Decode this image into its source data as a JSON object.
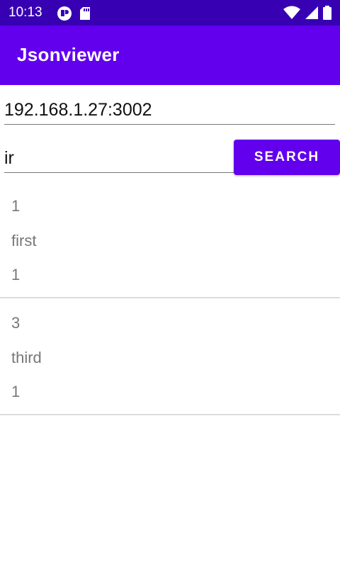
{
  "status_bar": {
    "time": "10:13",
    "icons_left": [
      "notification-app-icon",
      "sd-card-icon"
    ],
    "icons_right": [
      "wifi-icon",
      "signal-icon",
      "battery-icon"
    ],
    "background": "#3700b3"
  },
  "app_bar": {
    "title": "Jsonviewer",
    "background": "#6200ee"
  },
  "server_input": {
    "value": "192.168.1.27:3002"
  },
  "query_input": {
    "value": "ir"
  },
  "search_button": {
    "label": "SEARCH",
    "background": "#6200ee"
  },
  "results": [
    {
      "lines": [
        "1",
        "first",
        "1"
      ]
    },
    {
      "lines": [
        "3",
        "third",
        "1"
      ]
    }
  ]
}
